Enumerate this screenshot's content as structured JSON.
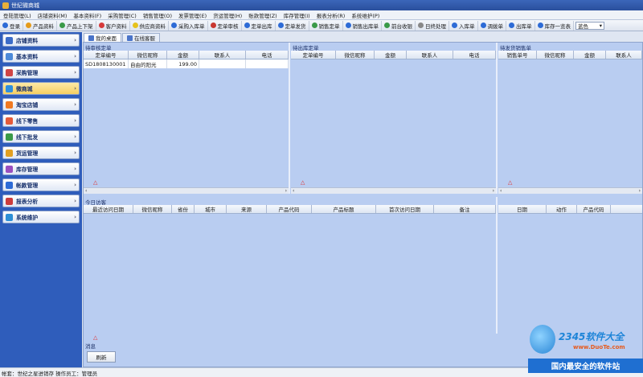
{
  "window": {
    "title": "世纪微商城"
  },
  "menu": [
    "登陆管理(L)",
    "店铺资料(M)",
    "基本资料(F)",
    "采购管理(C)",
    "销售管理(O)",
    "发票管理(E)",
    "货运管理(H)",
    "账款管理(Z)",
    "库存管理(I)",
    "报表分析(R)",
    "系统维护(P)"
  ],
  "toolbar": {
    "buttons": [
      {
        "label": "登录",
        "icon": "login-icon",
        "color": "#2d6bd6"
      },
      {
        "label": "产品资料",
        "icon": "product-icon",
        "color": "#e59b1b"
      },
      {
        "label": "产品上下架",
        "icon": "shelf-icon",
        "color": "#3a9a48"
      },
      {
        "label": "客户资料",
        "icon": "customer-icon",
        "color": "#d63a3a"
      },
      {
        "label": "供应商资料",
        "icon": "supplier-icon",
        "color": "#e6c21b"
      },
      {
        "label": "采购入库单",
        "icon": "purchase-icon",
        "color": "#2d6bd6"
      },
      {
        "label": "定单审核",
        "icon": "audit-icon",
        "color": "#c9372f"
      },
      {
        "label": "定单出库",
        "icon": "outbound-icon",
        "color": "#2d6bd6"
      },
      {
        "label": "定单发货",
        "icon": "ship-icon",
        "color": "#2d6bd6"
      },
      {
        "label": "销售定单",
        "icon": "sales-order-icon",
        "color": "#3a9a48"
      },
      {
        "label": "销售出库单",
        "icon": "sales-out-icon",
        "color": "#2d6bd6"
      },
      {
        "label": "前台收银",
        "icon": "cashier-icon",
        "color": "#3a9a48"
      },
      {
        "label": "日终处理",
        "icon": "day-end-icon",
        "color": "#888888"
      },
      {
        "label": "入库单",
        "icon": "inbound-icon",
        "color": "#2d6bd6"
      },
      {
        "label": "调拨单",
        "icon": "transfer-icon",
        "color": "#2d6bd6"
      },
      {
        "label": "出库单",
        "icon": "outbound-slip-icon",
        "color": "#2d6bd6"
      },
      {
        "label": "库存一览表",
        "icon": "inventory-icon",
        "color": "#2d6bd6"
      }
    ],
    "theme_value": "蓝色"
  },
  "sidebar": {
    "items": [
      {
        "label": "店铺资料",
        "icon": "store-icon",
        "color": "#3c6cc8"
      },
      {
        "label": "基本资料",
        "icon": "basic-info-icon",
        "color": "#4d8ad9"
      },
      {
        "label": "采购管理",
        "icon": "purchase-mgmt-icon",
        "color": "#d04545"
      },
      {
        "label": "微商城",
        "icon": "micro-mall-icon",
        "color": "#2f8fde"
      },
      {
        "label": "淘宝店铺",
        "icon": "taobao-icon",
        "color": "#f07a22"
      },
      {
        "label": "线下零售",
        "icon": "retail-icon",
        "color": "#e45b3a"
      },
      {
        "label": "线下批发",
        "icon": "wholesale-icon",
        "color": "#3a9a48"
      },
      {
        "label": "货运管理",
        "icon": "freight-icon",
        "color": "#e2a022"
      },
      {
        "label": "库存管理",
        "icon": "stock-icon",
        "color": "#9a4fbf"
      },
      {
        "label": "帐款管理",
        "icon": "accounts-icon",
        "color": "#2d6bd6"
      },
      {
        "label": "报表分析",
        "icon": "report-icon",
        "color": "#cc3c3c"
      },
      {
        "label": "系统维护",
        "icon": "system-icon",
        "color": "#2d8fd6"
      }
    ],
    "active_index": 3
  },
  "tabs": [
    {
      "label": "我的桌面",
      "active": true
    },
    {
      "label": "在线客服",
      "active": false
    }
  ],
  "panels": {
    "pending_audit": {
      "title": "待审核定单",
      "columns": [
        "定单编号",
        "微信昵称",
        "金额",
        "联系人",
        "电话"
      ],
      "rows": [
        [
          "SD1808130001",
          "自由的阳光",
          "199.00",
          "",
          ""
        ]
      ]
    },
    "pending_outbound": {
      "title": "待出库定单",
      "columns": [
        "定单编号",
        "微信昵称",
        "金额",
        "联系人",
        "电话"
      ],
      "rows": []
    },
    "pending_shipment": {
      "title": "待发货销售单",
      "columns": [
        "销售单号",
        "微信昵称",
        "金额",
        "联系人"
      ],
      "rows": []
    },
    "visitors": {
      "title": "今日访客",
      "columns": [
        "最近访问日期",
        "微信昵称",
        "省份",
        "城市",
        "来源",
        "产品代码",
        "产品标题",
        "首次访问日期",
        "备注"
      ],
      "right_columns": [
        "日期",
        "动作",
        "产品代码"
      ]
    },
    "message": {
      "title": "消息"
    }
  },
  "refresh_label": "刷新",
  "statusbar": "帐套：世纪之星进销存 操作员工：管理员",
  "watermark": {
    "brand": "2345软件大全",
    "url": "www.DuoTe.com",
    "slogan": "国内最安全的软件站"
  }
}
